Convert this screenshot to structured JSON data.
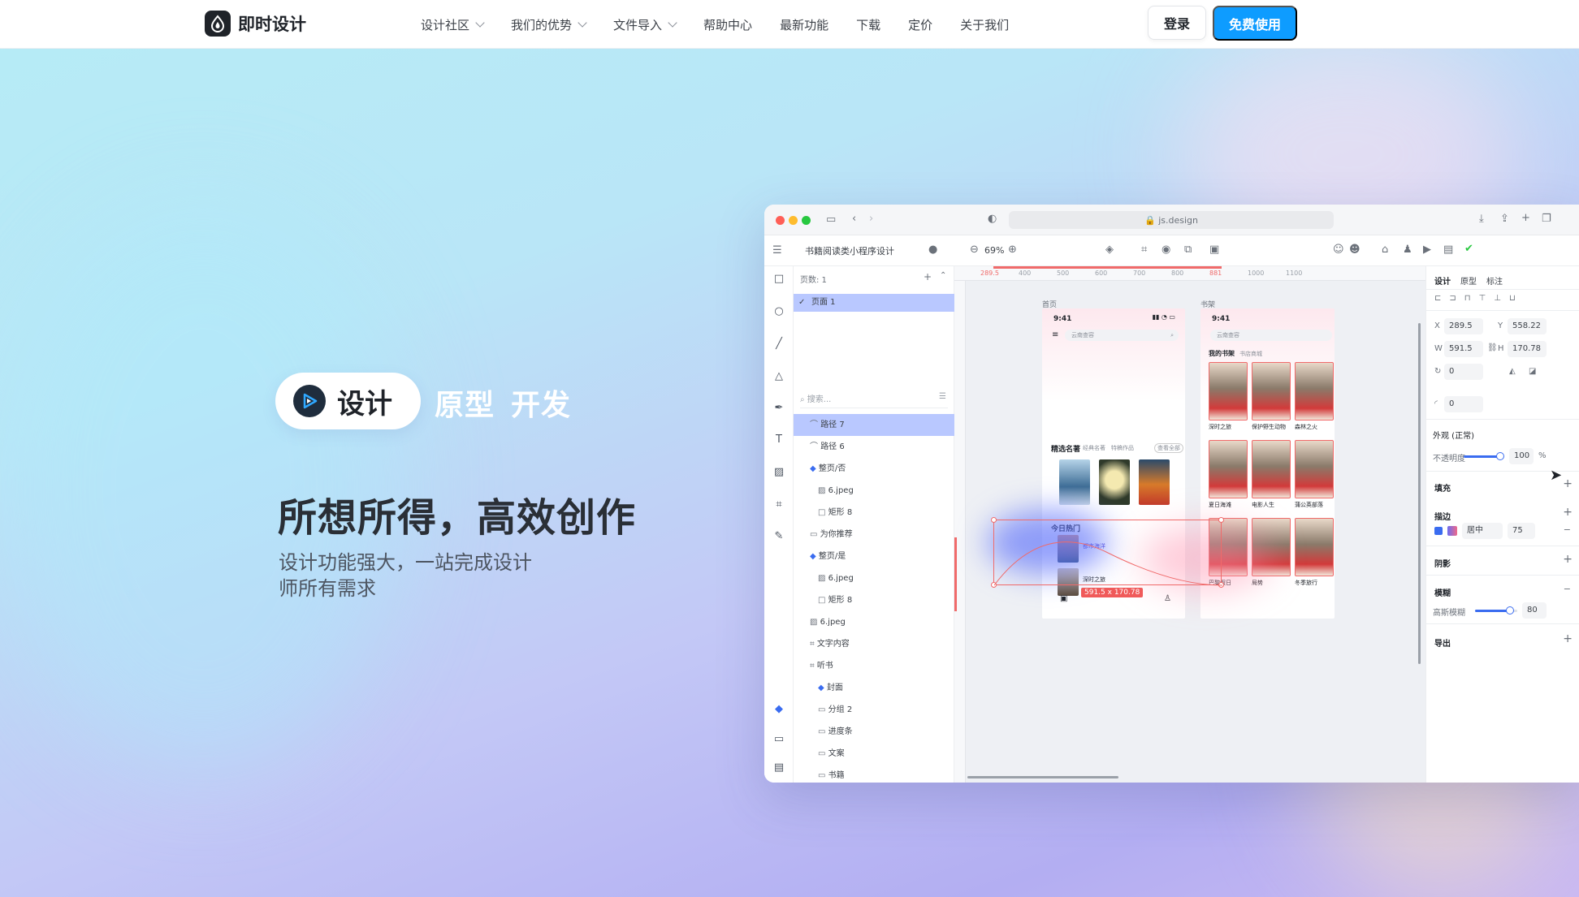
{
  "brand": {
    "name": "即时设计"
  },
  "nav": {
    "items": [
      {
        "label": "设计社区",
        "dropdown": true
      },
      {
        "label": "我们的优势",
        "dropdown": true
      },
      {
        "label": "文件导入",
        "dropdown": true
      },
      {
        "label": "帮助中心",
        "dropdown": false
      },
      {
        "label": "最新功能",
        "dropdown": false
      },
      {
        "label": "下载",
        "dropdown": false
      },
      {
        "label": "定价",
        "dropdown": false
      },
      {
        "label": "关于我们",
        "dropdown": false
      }
    ],
    "login_label": "登录",
    "free_label": "免费使用"
  },
  "hero": {
    "pill_label": "设计",
    "tab_prototype": "原型",
    "tab_develop": "开发",
    "headline": "所想所得，高效创作",
    "subline": "设计功能强大，一站完成设计师所有需求"
  },
  "app": {
    "url": "js.design",
    "project": "书籍阅读类小程序设计",
    "zoom": "69%",
    "pages_header": "页数: 1",
    "page_1": "页面 1",
    "search_placeholder": "搜索...",
    "layers": [
      "路径 7",
      "路径 6",
      "整页/否",
      "6.jpeg",
      "矩形 8",
      "为你推荐",
      "整页/是",
      "6.jpeg",
      "矩形 8",
      "6.jpeg",
      "文字内容",
      "听书",
      "封面",
      "分组 2",
      "进度条",
      "文案",
      "书籍"
    ],
    "frame_home": "首页",
    "frame_shelf": "书架",
    "phone_time": "9:41",
    "phone_search": "云南查容",
    "section_picked": "精选名著",
    "section_classic": "经典名著",
    "section_works": "特稿作品",
    "section_more": "查看全部",
    "section_hot": "今日热门",
    "hot_title_1": "都市海洋",
    "hot_title_2": "深时之旅",
    "shelf_title": "我的书架",
    "shelf_sub": "书店商城",
    "shelf_books": [
      "深时之旅",
      "保护野生动物",
      "森林之火",
      "夏日海滩",
      "电影人生",
      "蒲公英部落",
      "巴黎假日",
      "局势",
      "冬季旅行"
    ],
    "selection_size": "591.5 x 170.78",
    "ruler_top": [
      "289.5",
      "400",
      "500",
      "600",
      "700",
      "800",
      "881",
      "1000",
      "1100"
    ],
    "props": {
      "tab_design": "设计",
      "tab_prototype": "原型",
      "tab_mark": "标注",
      "x_label": "X",
      "x": "289.5",
      "y_label": "Y",
      "y": "558.22",
      "w_label": "W",
      "w": "591.5",
      "h_label": "H",
      "h": "170.78",
      "rotation": "0",
      "radius": "0",
      "appearance": "外观 (正常)",
      "opacity_label": "不透明度",
      "opacity": "100",
      "opacity_unit": "%",
      "fill": "填充",
      "stroke": "描边",
      "stroke_align": "居中",
      "stroke_width": "75",
      "shadow": "阴影",
      "blur": "模糊",
      "blur_type": "高斯模糊",
      "blur_value": "80",
      "export": "导出"
    }
  },
  "colors": {
    "accent": "#0e9cff",
    "selection": "#b9c8ff",
    "select_box": "#f06a6a"
  }
}
